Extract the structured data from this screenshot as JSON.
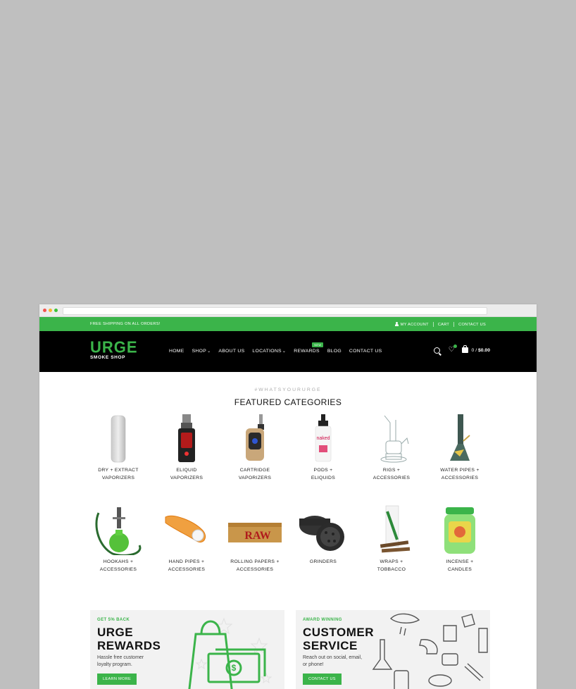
{
  "topbar": {
    "promo": "FREE SHIPPING ON ALL ORDERS!",
    "links": [
      "MY ACCOUNT",
      "CART",
      "CONTACT US"
    ]
  },
  "logo": {
    "main": "URGE",
    "sub": "SMOKE SHOP"
  },
  "nav": [
    {
      "label": "HOME"
    },
    {
      "label": "SHOP"
    },
    {
      "label": "ABOUT US"
    },
    {
      "label": "LOCATIONS"
    },
    {
      "label": "REWARDS",
      "badge": "NEW"
    },
    {
      "label": "BLOG"
    },
    {
      "label": "CONTACT US"
    }
  ],
  "cart": {
    "count": "0",
    "sep": "/",
    "total": "$0.00"
  },
  "featured": {
    "hashtag": "#WHATSYOURURGE",
    "title": "FEATURED CATEGORIES",
    "row1": [
      {
        "line1": "DRY + EXTRACT",
        "line2": "VAPORIZERS"
      },
      {
        "line1": "ELIQUID",
        "line2": "VAPORIZERS"
      },
      {
        "line1": "CARTRIDGE",
        "line2": "VAPORIZERS"
      },
      {
        "line1": "PODS +",
        "line2": "ELIQUIDS"
      },
      {
        "line1": "RIGS +",
        "line2": "ACCESSORIES"
      },
      {
        "line1": "WATER PIPES +",
        "line2": "ACCESSORIES"
      }
    ],
    "row2": [
      {
        "line1": "HOOKAHS +",
        "line2": "ACCESSORIES"
      },
      {
        "line1": "HAND PIPES +",
        "line2": "ACCESSORIES"
      },
      {
        "line1": "ROLLING PAPERS +",
        "line2": "ACCESSORIES"
      },
      {
        "line1": "GRINDERS",
        "line2": ""
      },
      {
        "line1": "WRAPS +",
        "line2": "TOBBACCO"
      },
      {
        "line1": "INCENSE +",
        "line2": "CANDLES"
      }
    ]
  },
  "product_text": {
    "raw": "RAW",
    "naked": "naked"
  },
  "promos": [
    {
      "eyebrow": "GET 5% BACK",
      "line1": "URGE",
      "line2": "REWARDS",
      "desc": "Hassle free customer loyalty program.",
      "button": "LEARN MORE"
    },
    {
      "eyebrow": "AWARD WINNING",
      "line1": "CUSTOMER",
      "line2": "SERVICE",
      "desc": "Reach out on social, email, or phone!",
      "button": "CONTACT US"
    }
  ],
  "colors": {
    "brand_green": "#3bb44a",
    "header_bg": "#000000",
    "page_bg": "#bfbfbf"
  }
}
